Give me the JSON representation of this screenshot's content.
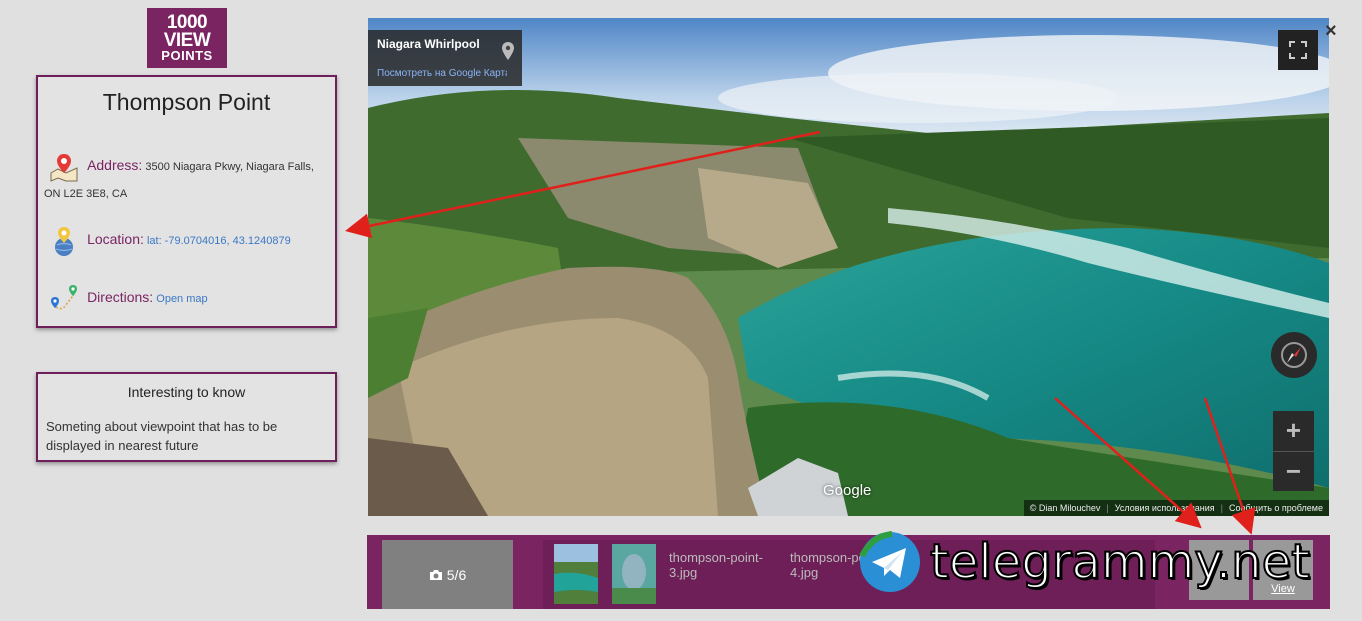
{
  "logo": {
    "line1": "1000",
    "line2": "VIEW",
    "line3": "POINTS"
  },
  "info": {
    "title": "Thompson Point",
    "address_label": "Address:",
    "address_value": "3500 Niagara Pkwy, Niagara Falls,",
    "address_cont": "ON L2E 3E8, CA",
    "location_label": "Location:",
    "location_value": "lat: -79.0704016, 43.1240879",
    "directions_label": "Directions:",
    "directions_link": "Open map"
  },
  "know": {
    "title": "Interesting to know",
    "text": "Someting about viewpoint that has to be displayed in nearest future"
  },
  "viewer": {
    "place_name": "Niagara Whirlpool",
    "view_on_google": "Посмотреть на Google Картах",
    "google_logo": "Google",
    "footer": {
      "credit": "© Dian Milouchev",
      "terms": "Условия использования",
      "report": "Сообщить о проблеме"
    }
  },
  "close_icon": "×",
  "strip": {
    "counter": "5/6",
    "broken_thumbs": [
      "thompson-point-3.jpg",
      "thompson-point-4.jpg"
    ],
    "view_label": "View"
  },
  "watermark": {
    "text": "telegrammy.net"
  },
  "colors": {
    "brand": "#7a2462",
    "panel_border": "#6d1f5a",
    "link": "#3b78c4",
    "annotation_arrow": "#e0201a"
  }
}
